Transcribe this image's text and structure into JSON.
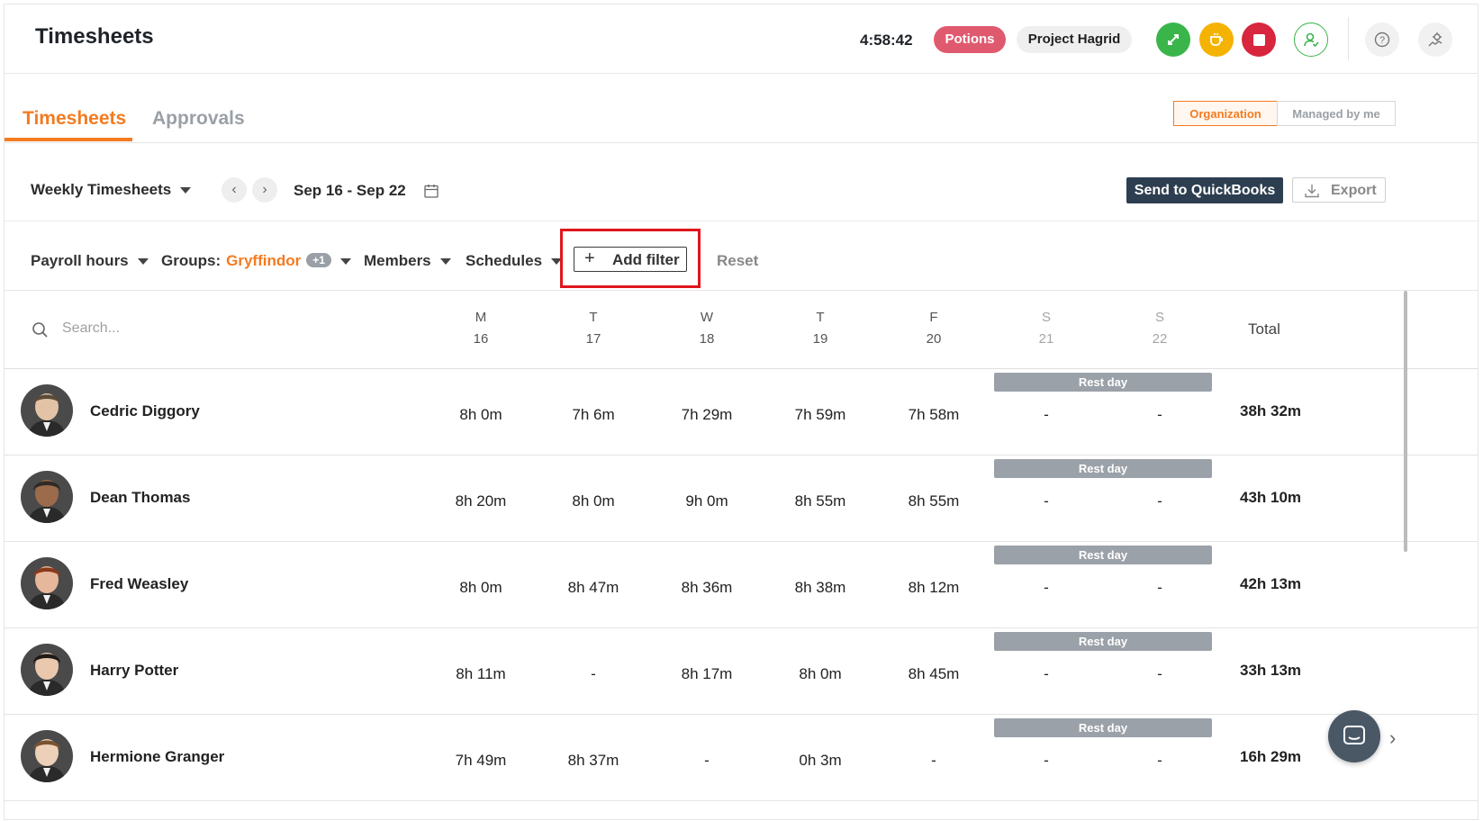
{
  "header": {
    "title": "Timesheets",
    "timer": "4:58:42",
    "activity_pill": "Potions",
    "project_pill": "Project Hagrid",
    "icons": [
      "map-pin-icon",
      "coffee-icon",
      "stop-icon",
      "user-check-icon",
      "help-icon",
      "settings-icon"
    ]
  },
  "tabs": {
    "active": "Timesheets",
    "inactive": "Approvals",
    "scope_organization": "Organization",
    "scope_managed": "Managed by me"
  },
  "controls": {
    "view": "Weekly Timesheets",
    "date_range": "Sep 16 - Sep 22",
    "send_button": "Send to QuickBooks",
    "export_button": "Export"
  },
  "filters": {
    "payroll": "Payroll hours",
    "groups_label": "Groups",
    "groups_value": "Gryffindor",
    "groups_more": "+1",
    "members": "Members",
    "schedules": "Schedules",
    "add_filter": "Add filter",
    "reset": "Reset"
  },
  "table": {
    "search_placeholder": "Search...",
    "days": [
      {
        "letter": "M",
        "num": "16"
      },
      {
        "letter": "T",
        "num": "17"
      },
      {
        "letter": "W",
        "num": "18"
      },
      {
        "letter": "T",
        "num": "19"
      },
      {
        "letter": "F",
        "num": "20"
      },
      {
        "letter": "S",
        "num": "21"
      },
      {
        "letter": "S",
        "num": "22"
      }
    ],
    "total_label": "Total",
    "rest_label": "Rest day",
    "rows": [
      {
        "name": "Cedric Diggory",
        "hours": [
          "8h 0m",
          "7h 6m",
          "7h 29m",
          "7h 59m",
          "7h 58m",
          "-",
          "-"
        ],
        "total": "38h 32m"
      },
      {
        "name": "Dean Thomas",
        "hours": [
          "8h 20m",
          "8h 0m",
          "9h 0m",
          "8h 55m",
          "8h 55m",
          "-",
          "-"
        ],
        "total": "43h 10m"
      },
      {
        "name": "Fred Weasley",
        "hours": [
          "8h 0m",
          "8h 47m",
          "8h 36m",
          "8h 38m",
          "8h 12m",
          "-",
          "-"
        ],
        "total": "42h 13m"
      },
      {
        "name": "Harry Potter",
        "hours": [
          "8h 11m",
          "-",
          "8h 17m",
          "8h 0m",
          "8h 45m",
          "-",
          "-"
        ],
        "total": "33h 13m"
      },
      {
        "name": "Hermione Granger",
        "hours": [
          "7h 49m",
          "8h 37m",
          "-",
          "0h 3m",
          "-",
          "-",
          "-"
        ],
        "total": "16h 29m"
      }
    ]
  },
  "colors": {
    "accent": "#f47b20",
    "potions": "#e05a6f",
    "quickbooks": "#2d3e50",
    "rest_day": "#9ba1a8",
    "highlight": "#e0161d"
  }
}
